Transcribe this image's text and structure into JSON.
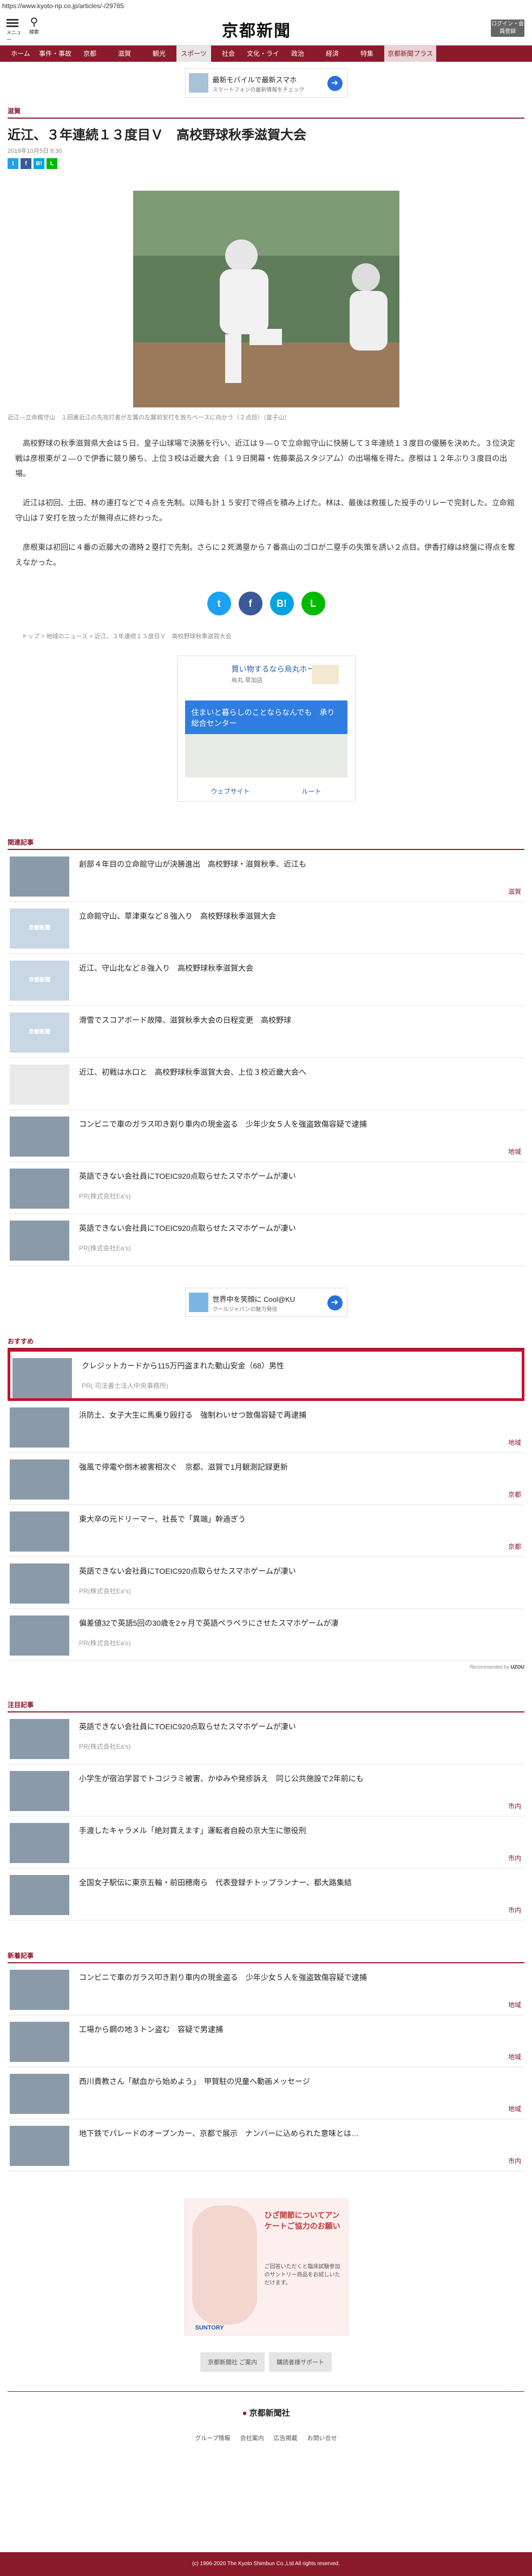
{
  "url": "https://www.kyoto-np.co.jp/articles/-/29785",
  "masthead": {
    "menu_label": "メニュー",
    "search_label": "検索",
    "logo": "京都新聞",
    "member_button": "ログイン・会員登録"
  },
  "nav": [
    "ホーム",
    "事件・事故",
    "京都",
    "滋賀",
    "観光",
    "スポーツ",
    "社会",
    "文化・ライフ",
    "政治",
    "経済",
    "特集",
    "京都新聞プラス"
  ],
  "ad_top": {
    "title": "最新モバイルで最新スマホ",
    "sub": "スマートフォンの最新情報をチェック"
  },
  "section": "滋賀",
  "article": {
    "headline": "近江、３年連続１３度目Ｖ　高校野球秋季滋賀大会",
    "date": "2019年10月5日 8:30",
    "caption": "近江―立命館守山　１回裏近江の先攻打者が左翼の左翼前安打を放ちベースに向かう（２点目）（皇子山）",
    "paragraphs": [
      "　高校野球の秋季滋賀県大会は５日、皇子山球場で決勝を行い、近江は９―０で立命館守山に快勝して３年連続１３度目の優勝を決めた。３位決定戦は彦根東が２―０で伊香に競り勝ち、上位３校は近畿大会（１９日開幕・佐藤薬品スタジアム）の出場権を得た。彦根は１２年ぶり３度目の出場。",
      "　近江は初回、土田、林の連打などで４点を先制。以降も計１５安打で得点を積み上げた。林は、最後は救援した投手のリレーで完封した。立命館守山は７安打を放ったが無得点に終わった。",
      "　彦根東は初回に４番の近藤大の適時２塁打で先制。さらに２死満塁から７番高山のゴロが二塁手の失策を誘い２点目。伊香打線は終盤に得点を奪えなかった。"
    ]
  },
  "breadcrumb": [
    "トップ",
    "地域のニュース",
    "近江、３年連続１３度目Ｖ　高校野球秋季滋賀大会"
  ],
  "map_ad": {
    "title": "買い物するなら烏丸ホームズ",
    "sub": "烏丸 草加店",
    "banner": "住まいと暮らしのことならなんでも　承り総合センター",
    "left_btn": "ウェブサイト",
    "right_btn": "ルート"
  },
  "related": {
    "label": "関連記事",
    "items": [
      {
        "title": "創部４年目の立命館守山が決勝進出　高校野球・滋賀秋季、近江も",
        "sub": "",
        "cat": "滋賀",
        "thumb": "photo"
      },
      {
        "title": "立命館守山、草津東など８強入り　高校野球秋季滋賀大会",
        "sub": "",
        "cat": "",
        "thumb": "placeholder"
      },
      {
        "title": "近江、守山北など８強入り　高校野球秋季滋賀大会",
        "sub": "",
        "cat": "",
        "thumb": "placeholder"
      },
      {
        "title": "滑雪でスコアボード故障、滋賀秋季大会の日程変更　高校野球",
        "sub": "",
        "cat": "",
        "thumb": "placeholder"
      },
      {
        "title": "近江、初戦は水口と　高校野球秋季滋賀大会、上位３校近畿大会へ",
        "sub": "",
        "cat": "",
        "thumb": "doc"
      },
      {
        "title": "コンビニで車のガラス叩き割り車内の現金盗る　少年少女５人を強盗致傷容疑で逮捕",
        "sub": "",
        "cat": "地域",
        "thumb": "photo"
      },
      {
        "title": "英語できない会社員にTOEIC920点取らせたスマホゲームが凄い",
        "sub": "PR(株式会社Ea's)",
        "cat": "",
        "thumb": "photo"
      },
      {
        "title": "英語できない会社員にTOEIC920点取らせたスマホゲームが凄い",
        "sub": "PR(株式会社Ea's)",
        "cat": "",
        "thumb": "photo"
      }
    ]
  },
  "ad_mid": {
    "title": "世界中を笑顔に Cool@KU",
    "sub": "クールジャパンの魅力発信"
  },
  "recommend": {
    "label": "おすすめ",
    "items": [
      {
        "title": "クレジットカードから115万円盗まれた動山安金（68）男性",
        "sub": "PR( 司法書士法人中央事務所)",
        "cat": "",
        "thumb": "photo",
        "highlight": true
      },
      {
        "title": "浜防土、女子大生に馬乗り殴打る　強制わいせつ致傷容疑で再逮捕",
        "sub": "",
        "cat": "地域",
        "thumb": "photo"
      },
      {
        "title": "強風で停電や倒木被害相次ぐ　京都、滋賀で1月観測記録更新",
        "sub": "",
        "cat": "京都",
        "thumb": "photo"
      },
      {
        "title": "東大卒の元ドリーマー、社長で「異端」幹過ぎう",
        "sub": "",
        "cat": "京都",
        "thumb": "photo"
      },
      {
        "title": "英語できない会社員にTOEIC920点取らせたスマホゲームが凄い",
        "sub": "PR(株式会社Ea's)",
        "cat": "",
        "thumb": "photo"
      },
      {
        "title": "偏差値32で英語5回の30歳を2ヶ月で英語ペラペラにさせたスマホゲームが凄",
        "sub": "PR(株式会社Ea's)",
        "cat": "",
        "thumb": "photo"
      }
    ],
    "powered_by": "Recommended by"
  },
  "popular": {
    "label": "注目記事",
    "items": [
      {
        "title": "英語できない会社員にTOEIC920点取らせたスマホゲームが凄い",
        "sub": "PR(株式会社Ea's)",
        "cat": "",
        "thumb": "photo"
      },
      {
        "title": "小学生が宿泊学習でトコジラミ被害、かゆみや発疹訴え　同じ公共施設で2年前にも",
        "sub": "",
        "cat": "市内",
        "thumb": "photo"
      },
      {
        "title": "手渡したキャラメル「絶対買えます」運転者自殺の京大生に懲役刑",
        "sub": "",
        "cat": "市内",
        "thumb": "photo"
      },
      {
        "title": "全国女子駅伝に東京五輪・前田穂南ら　代表登録チトップランナー、都大路集結",
        "sub": "",
        "cat": "市内",
        "thumb": "photo"
      }
    ]
  },
  "latest": {
    "label": "新着記事",
    "items": [
      {
        "title": "コンビニで車のガラス叩き割り車内の現金盗る　少年少女５人を強盗致傷容疑で逮捕",
        "sub": "",
        "cat": "地域",
        "thumb": "photo"
      },
      {
        "title": "工場から鋼の地３トン盗む　容疑で男逮捕",
        "sub": "",
        "cat": "地域",
        "thumb": "photo"
      },
      {
        "title": "西川貴教さん「献血から始めよう」　甲賀駐の児童へ動画メッセージ",
        "sub": "",
        "cat": "地域",
        "thumb": "photo"
      },
      {
        "title": "地下鉄でパレードのオープンカー、京都で展示　ナンバーに込められた意味とは…",
        "sub": "",
        "cat": "市内",
        "thumb": "photo"
      }
    ]
  },
  "bottom_ad": {
    "headline": "ひざ関節についてアンケートご協力のお願い",
    "small": "ご回答いただくと臨床試験参加のサントリー商品をお試しいただけます。",
    "brand": "SUNTORY"
  },
  "buttons": [
    "京都新聞社 ご案内",
    "購読者様サポート"
  ],
  "footer": {
    "brand": "京都新聞社",
    "links": [
      "グループ情報",
      "会社案内",
      "広告掲載",
      "お問い合せ"
    ],
    "copyright": "(c) 1996-2020 The Kyoto Shimbun Co.,Ltd All rights reserved."
  },
  "colors": {
    "brand": "#8b1a2b",
    "highlight": "#c8102e"
  }
}
